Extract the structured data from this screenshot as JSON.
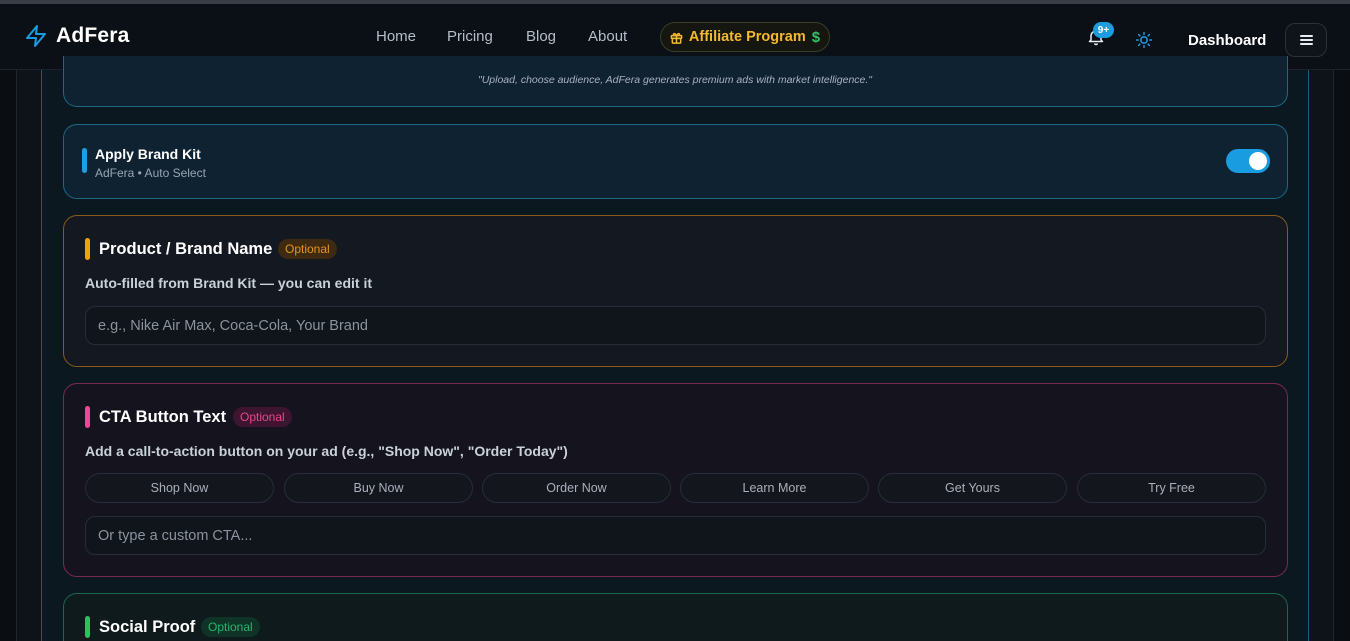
{
  "header": {
    "brand": "AdFera",
    "nav": [
      "Home",
      "Pricing",
      "Blog",
      "About"
    ],
    "affiliate_label": "Affiliate Program",
    "affiliate_symbol": "$",
    "notifications_badge": "9+",
    "dashboard_label": "Dashboard",
    "accent_color": "#1a9de0"
  },
  "tagline": "\"Upload, choose audience, AdFera generates premium ads with market intelligence.\"",
  "brand_kit": {
    "title": "Apply Brand Kit",
    "subtitle": "AdFera • Auto Select",
    "enabled": true
  },
  "product": {
    "title": "Product / Brand Name",
    "badge": "Optional",
    "description": "Auto-filled from Brand Kit — you can edit it",
    "placeholder": "e.g., Nike Air Max, Coca-Cola, Your Brand",
    "value": ""
  },
  "cta": {
    "title": "CTA Button Text",
    "badge": "Optional",
    "description": "Add a call-to-action button on your ad (e.g., \"Shop Now\", \"Order Today\")",
    "options": [
      "Shop Now",
      "Buy Now",
      "Order Now",
      "Learn More",
      "Get Yours",
      "Try Free"
    ],
    "placeholder": "Or type a custom CTA...",
    "value": ""
  },
  "social_proof": {
    "title": "Social Proof",
    "badge": "Optional"
  }
}
